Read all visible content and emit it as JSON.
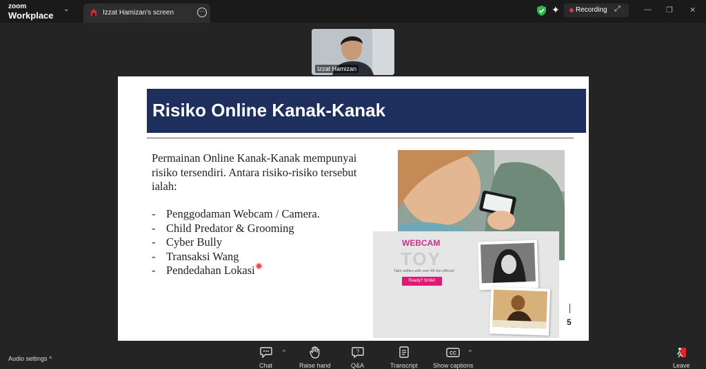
{
  "app": {
    "brand_line1": "zoom",
    "brand_line2": "Workplace"
  },
  "tab": {
    "label": "Izzat Hamizan's screen",
    "more": "···"
  },
  "status": {
    "recording_label": "Recording"
  },
  "window_controls": {
    "minimize": "—",
    "restore": "❐",
    "close": "✕"
  },
  "participant": {
    "name": "Izzat Hamizan"
  },
  "slide": {
    "title": "Risiko Online Kanak-Kanak",
    "intro": "Permainan Online Kanak-Kanak mempunyai risiko tersendiri. Antara risiko-risiko tersebut ialah:",
    "bullet_marker": "-",
    "bullets": [
      "Penggodaman Webcam / Camera.",
      "Child Predator & Grooming",
      "Cyber Bully",
      "Transaksi Wang",
      "Pendedahan Lokasi"
    ],
    "page_number": "5",
    "webcam": {
      "title": "WEBCAM",
      "logo": "TOY",
      "tagline": "Take selfies with over 80 fun effects!",
      "button": "Ready? Smile!"
    }
  },
  "bottom": {
    "audio_settings": "Audio settings",
    "controls": {
      "chat": "Chat",
      "raise_hand": "Raise hand",
      "qa": "Q&A",
      "transcript": "Transcript",
      "show_captions": "Show captions",
      "leave": "Leave"
    },
    "caret": "^"
  },
  "colors": {
    "title_bar": "#1f2f5d",
    "recording": "#e0334e",
    "shield": "#2fb84f",
    "webcam_pink": "#e21874"
  }
}
